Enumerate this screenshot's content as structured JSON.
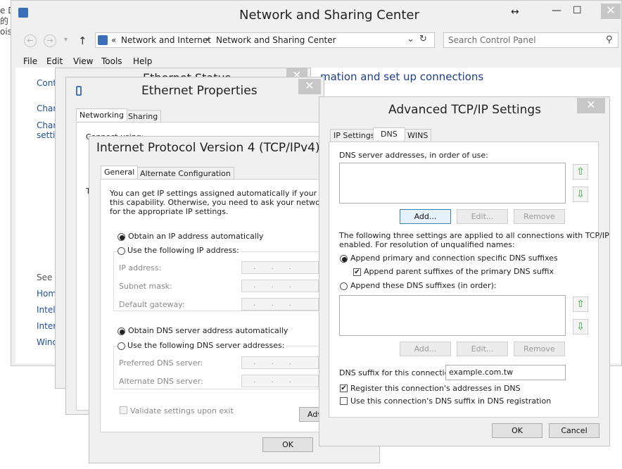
{
  "background_text": [
    "e D",
    "的",
    "oist"
  ],
  "main_window": {
    "title": "Network and Sharing Center",
    "resize_glyph": "↔",
    "minimize_glyph": "—",
    "maximize_glyph": "☐",
    "close_glyph": "✕",
    "back_glyph": "←",
    "forward_glyph": "→",
    "recent_glyph": "▾",
    "up_glyph": "↑",
    "breadcrumb": {
      "prefix": "«",
      "items": [
        "Network and Internet",
        "Network and Sharing Center"
      ],
      "separator": "▸"
    },
    "dropdown_glyph": "⌄",
    "refresh_glyph": "↻",
    "search_placeholder": "Search Control Panel",
    "search_glyph": "⚲",
    "menu": [
      "File",
      "Edit",
      "View",
      "Tools",
      "Help"
    ],
    "heading_partial": "mation and set up connections",
    "sidebar_partial": [
      "Cont",
      "Char",
      "Char",
      "settir"
    ],
    "see_also_partial": [
      "See a",
      "Hom",
      "Intel",
      "Inter",
      "Wind"
    ]
  },
  "ethernet_status": {
    "title_partial": "Ethernet Status",
    "close_glyph": "✕"
  },
  "ethernet_properties": {
    "title": "Ethernet Properties",
    "close_glyph": "✕",
    "tabs": [
      "Networking",
      "Sharing"
    ],
    "partial_label": "Connect using:",
    "partial_t": "T"
  },
  "ipv4": {
    "title": "Internet Protocol Version 4 (TCP/IPv4)",
    "tabs": [
      "General",
      "Alternate Configuration"
    ],
    "description": [
      "You can get IP settings assigned automatically if your network",
      "this capability. Otherwise, you need to ask your network admi",
      "for the appropriate IP settings."
    ],
    "obtain_ip_auto": "Obtain an IP address automatically",
    "use_following_ip": "Use the following IP address:",
    "ip_address": "IP address:",
    "subnet_mask": "Subnet mask:",
    "default_gateway": "Default gateway:",
    "ip_placeholder": "...",
    "obtain_dns_auto": "Obtain DNS server address automatically",
    "use_following_dns": "Use the following DNS server addresses:",
    "preferred_dns": "Preferred DNS server:",
    "alternate_dns": "Alternate DNS server:",
    "validate_on_exit": "Validate settings upon exit",
    "advanced_partial": "Adv",
    "ok": "OK"
  },
  "advanced_tcpip": {
    "title": "Advanced TCP/IP Settings",
    "close_glyph": "✕",
    "tabs": [
      "IP Settings",
      "DNS",
      "WINS"
    ],
    "dns_servers_label": "DNS server addresses, in order of use:",
    "up_glyph": "⇧",
    "down_glyph": "⇩",
    "add": "Add...",
    "edit": "Edit...",
    "remove": "Remove",
    "settings_note": [
      "The following three settings are applied to all connections with TCP/IP",
      "enabled. For resolution of unqualified names:"
    ],
    "append_primary": "Append primary and connection specific DNS suffixes",
    "append_parent": "Append parent suffixes of the primary DNS suffix",
    "append_these": "Append these DNS suffixes (in order):",
    "dns_suffix_label": "DNS suffix for this connection:",
    "dns_suffix_value": "example.com.tw",
    "register": "Register this connection's addresses in DNS",
    "use_suffix": "Use this connection's DNS suffix in DNS registration",
    "checkmark": "✔",
    "ok": "OK",
    "cancel": "Cancel"
  }
}
